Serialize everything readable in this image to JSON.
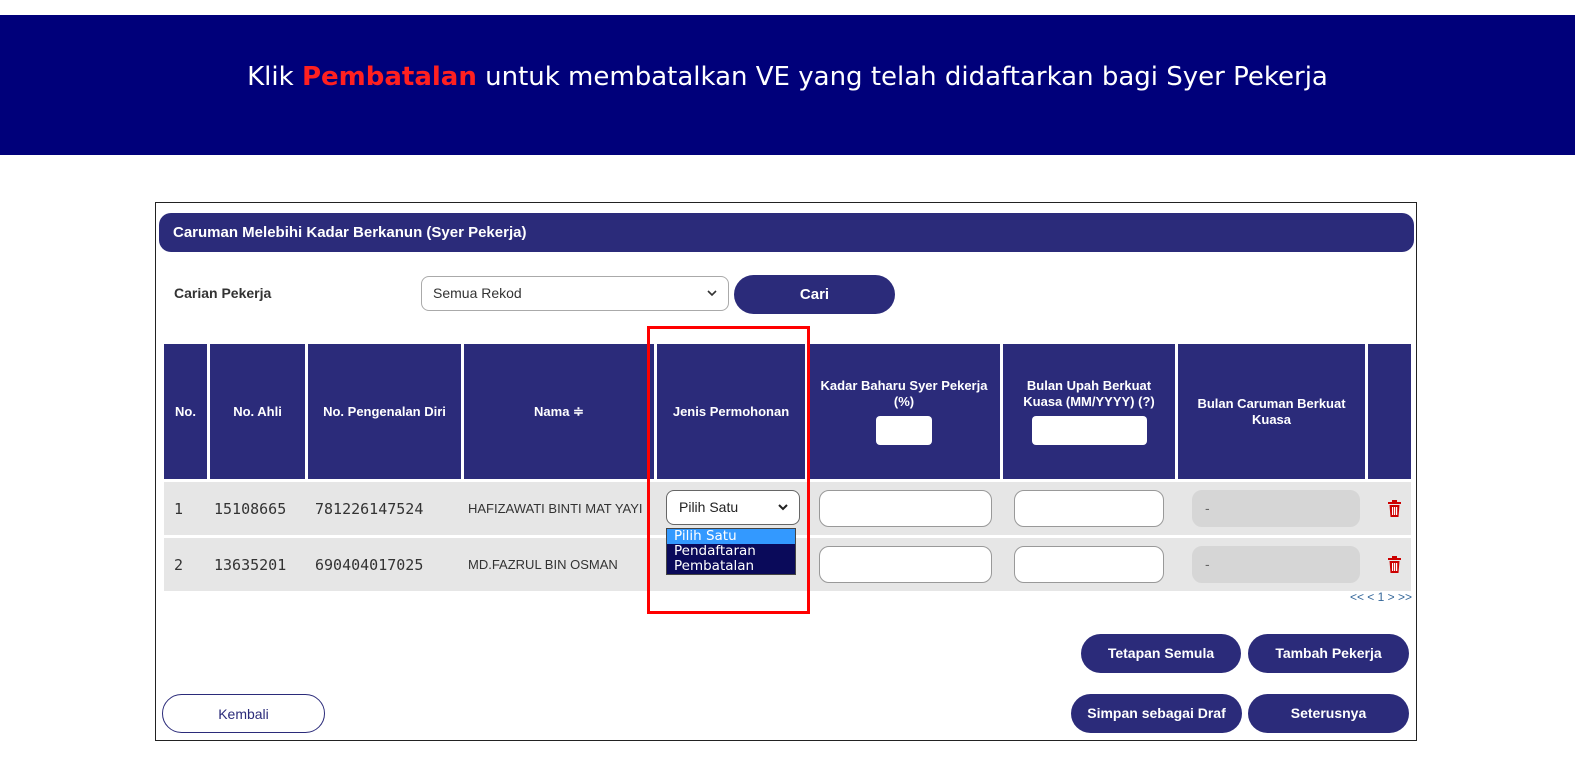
{
  "banner": {
    "prefix": "Klik ",
    "highlight": "Pembatalan",
    "suffix": " untuk membatalkan VE yang telah didaftarkan bagi Syer Pekerja"
  },
  "panel": {
    "title": "Caruman Melebihi Kadar Berkanun (Syer Pekerja)"
  },
  "search": {
    "label": "Carian Pekerja",
    "selected": "Semua Rekod",
    "button": "Cari"
  },
  "table": {
    "headers": {
      "no": "No.",
      "no_ahli": "No. Ahli",
      "no_pengenalan": "No. Pengenalan Diri",
      "nama": "Nama ≑",
      "jenis": "Jenis Permohonan",
      "kadar": "Kadar Baharu Syer Pekerja (%)",
      "bulan_upah": "Bulan Upah Berkuat Kuasa (MM/YYYY)  (?)",
      "bulan_caruman": "Bulan Caruman Berkuat Kuasa"
    },
    "rows": [
      {
        "no": "1",
        "no_ahli": "15108665",
        "ic": "781226147524",
        "nama": "HAFIZAWATI BINTI MAT YAYI",
        "jenis": "Pilih Satu",
        "bulan_caruman": "-"
      },
      {
        "no": "2",
        "no_ahli": "13635201",
        "ic": "690404017025",
        "nama": "MD.FAZRUL BIN OSMAN",
        "jenis": "",
        "bulan_caruman": "-"
      }
    ]
  },
  "dropdown": {
    "options": [
      "Pilih Satu",
      "Pendaftaran",
      "Pembatalan"
    ],
    "selected": "Pilih Satu"
  },
  "pager": "<< < 1 > >>",
  "buttons": {
    "reset": "Tetapan Semula",
    "add": "Tambah Pekerja",
    "draft": "Simpan sebagai Draf",
    "next": "Seterusnya",
    "back": "Kembali"
  },
  "colors": {
    "banner": "#00007a",
    "primary": "#2b2b7a",
    "highlight": "#ff2020",
    "dropdown_selected": "#3399ff"
  }
}
